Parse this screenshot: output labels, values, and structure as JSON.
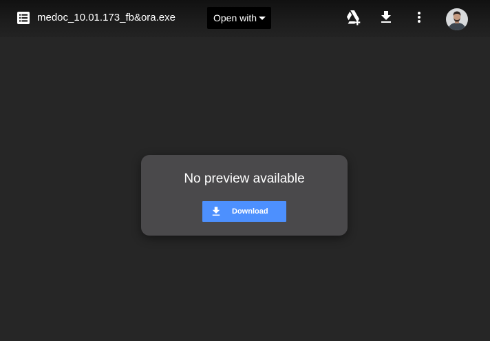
{
  "header": {
    "file_name": "medoc_10.01.173_fb&ora.exe",
    "file_icon": "file-list-icon",
    "open_with_label": "Open with",
    "actions": [
      {
        "name": "add-to-drive",
        "icon": "drive-add-icon"
      },
      {
        "name": "download",
        "icon": "download-icon"
      },
      {
        "name": "more-options",
        "icon": "more-vert-icon"
      }
    ],
    "avatar_icon": "account-avatar"
  },
  "preview": {
    "message": "No preview available",
    "download_label": "Download",
    "download_icon": "download-icon"
  },
  "colors": {
    "background": "#262626",
    "card": "#4a494b",
    "download_button": "#4d90fe",
    "open_with_button": "#000000"
  }
}
